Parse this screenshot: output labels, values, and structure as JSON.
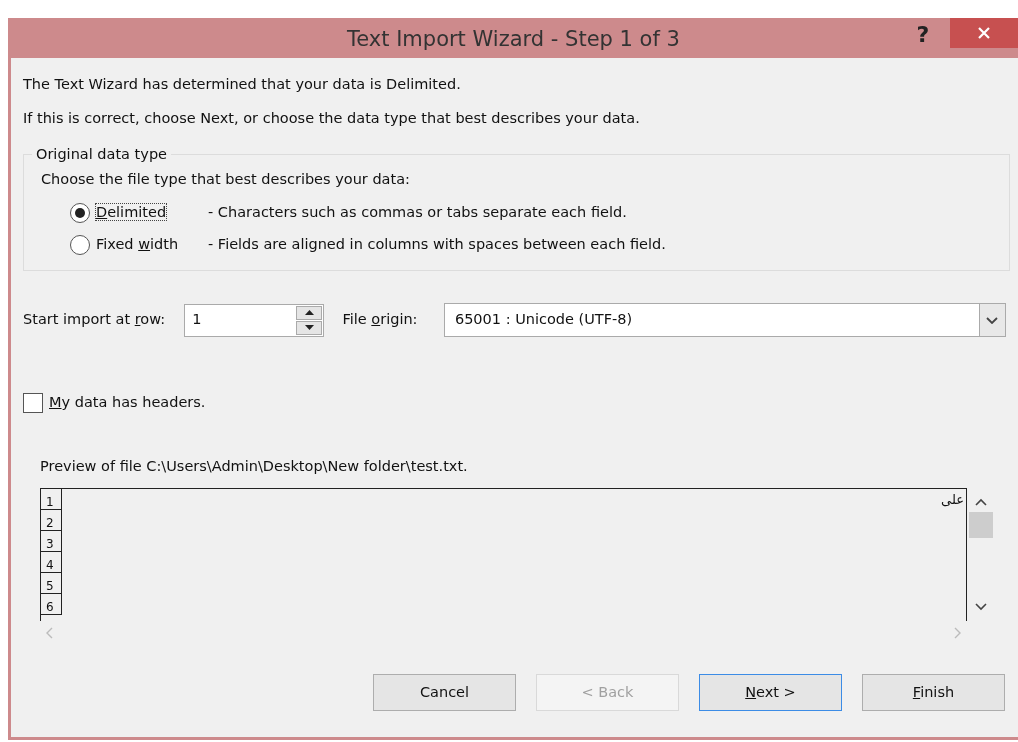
{
  "window": {
    "title": "Text Import Wizard - Step 1 of 3",
    "help": "?"
  },
  "intro": [
    "The Text Wizard has determined that your data is Delimited.",
    "If this is correct, choose Next, or choose the data type that best describes your data."
  ],
  "data_type_group": {
    "legend": "Original data type",
    "prompt": "Choose the file type that best describes your data:",
    "options": [
      {
        "label": {
          "key": "D",
          "post": "elimited"
        },
        "description": "- Characters such as commas or tabs separate each field.",
        "selected": true
      },
      {
        "label": {
          "pre": "Fixed ",
          "key": "w",
          "post": "idth"
        },
        "description": "- Fields are aligned in columns with spaces between each field.",
        "selected": false
      }
    ]
  },
  "start_row": {
    "label": {
      "pre": "Start import at ",
      "key": "r",
      "post": "ow:"
    },
    "value": "1"
  },
  "file_origin": {
    "label": {
      "pre": "File ",
      "key": "o",
      "post": "rigin:"
    },
    "value": "65001 : Unicode (UTF-8)"
  },
  "headers_checkbox": {
    "label": {
      "key": "M",
      "post": "y data has headers."
    },
    "checked": false
  },
  "preview": {
    "caption": "Preview of file C:\\Users\\Admin\\Desktop\\New folder\\test.txt.",
    "rows": [
      {
        "number": "1",
        "text": "علی"
      },
      {
        "number": "2"
      },
      {
        "number": "3"
      },
      {
        "number": "4"
      },
      {
        "number": "5"
      },
      {
        "number": "6"
      }
    ]
  },
  "buttons": [
    {
      "label": {
        "pre": "Cancel"
      },
      "disabled": false,
      "default": false
    },
    {
      "label": {
        "pre": "< Back"
      },
      "disabled": true,
      "default": false
    },
    {
      "label": {
        "key": "N",
        "post": "ext >"
      },
      "disabled": false,
      "default": true
    },
    {
      "label": {
        "key": "F",
        "post": "inish"
      },
      "disabled": false,
      "default": false
    }
  ]
}
